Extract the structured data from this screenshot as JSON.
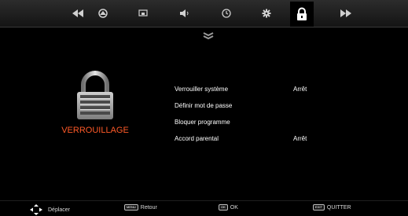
{
  "top_nav": {
    "tabs": [
      {
        "icon": "rewind-icon",
        "active": false
      },
      {
        "icon": "picture-icon",
        "active": false
      },
      {
        "icon": "screen-icon",
        "active": false
      },
      {
        "icon": "sound-icon",
        "active": false
      },
      {
        "icon": "clock-icon",
        "active": false
      },
      {
        "icon": "settings-gear-icon",
        "active": false
      },
      {
        "icon": "lock-icon",
        "active": true
      },
      {
        "icon": "fast-forward-icon",
        "active": false
      }
    ]
  },
  "section": {
    "icon": "padlock-icon",
    "title": "VERROUILLAGE"
  },
  "menu": {
    "items": [
      {
        "label": "Verrouiller système",
        "value": "Arrêt"
      },
      {
        "label": "Définir mot de passe",
        "value": ""
      },
      {
        "label": "Bloquer programme",
        "value": ""
      },
      {
        "label": "Accord parental",
        "value": "Arrêt"
      }
    ]
  },
  "footer": {
    "move_label": "Déplacer",
    "menu_key": "MENU",
    "back_label": "Retour",
    "ok_key": "OK",
    "ok_label": "OK",
    "exit_key": "EXIT",
    "exit_label": "QUITTER"
  },
  "colors": {
    "accent_title": "#ff5a28",
    "background": "#000000"
  }
}
